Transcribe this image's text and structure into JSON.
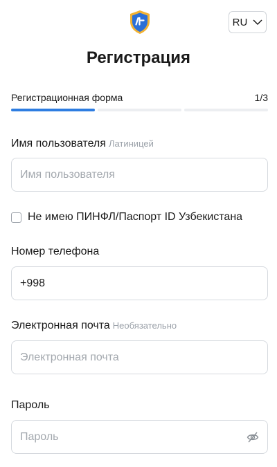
{
  "header": {
    "logo_icon": "shield-logo-icon",
    "language": "RU",
    "chevron_icon": "chevron-down-icon"
  },
  "page_title": "Регистрация",
  "steps": {
    "label": "Регистрационная форма",
    "counter": "1/3",
    "current": 1,
    "total": 3
  },
  "form": {
    "username": {
      "label": "Имя пользователя",
      "hint": "Латиницей",
      "placeholder": "Имя пользователя",
      "value": ""
    },
    "no_pinfl": {
      "label": "Не имею ПИНФЛ/Паспорт ID Узбекистана",
      "checked": false
    },
    "phone": {
      "label": "Номер телефона",
      "value": "+998"
    },
    "email": {
      "label": "Электронная почта",
      "hint": "Необязательно",
      "placeholder": "Электронная почта",
      "value": ""
    },
    "password": {
      "label": "Пароль",
      "placeholder": "Пароль",
      "value": "",
      "toggle_icon": "eye-off-icon"
    }
  },
  "colors": {
    "accent": "#2e7de1",
    "logo_blue": "#2b6fd6",
    "logo_gold": "#f2b233"
  }
}
